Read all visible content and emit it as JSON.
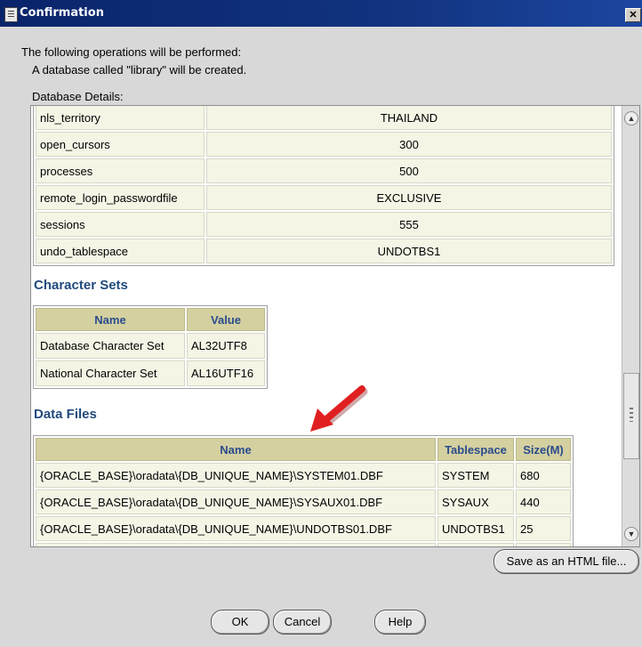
{
  "window": {
    "title": "Confirmation",
    "close_label": "✕"
  },
  "intro": {
    "line1": "The following operations will be performed:",
    "line2": "A database called \"library\" will be created.",
    "details_label": "Database Details:"
  },
  "parameters": [
    {
      "name": "nls_territory",
      "value": "THAILAND"
    },
    {
      "name": "open_cursors",
      "value": "300"
    },
    {
      "name": "processes",
      "value": "500"
    },
    {
      "name": "remote_login_passwordfile",
      "value": "EXCLUSIVE"
    },
    {
      "name": "sessions",
      "value": "555"
    },
    {
      "name": "undo_tablespace",
      "value": "UNDOTBS1"
    }
  ],
  "character_sets": {
    "heading": "Character Sets",
    "columns": [
      "Name",
      "Value"
    ],
    "rows": [
      {
        "name": "Database Character Set",
        "value": "AL32UTF8"
      },
      {
        "name": "National Character Set",
        "value": "AL16UTF16"
      }
    ]
  },
  "data_files": {
    "heading": "Data Files",
    "columns": [
      "Name",
      "Tablespace",
      "Size(M)"
    ],
    "rows": [
      {
        "name": "{ORACLE_BASE}\\oradata\\{DB_UNIQUE_NAME}\\SYSTEM01.DBF",
        "tablespace": "SYSTEM",
        "size": "680"
      },
      {
        "name": "{ORACLE_BASE}\\oradata\\{DB_UNIQUE_NAME}\\SYSAUX01.DBF",
        "tablespace": "SYSAUX",
        "size": "440"
      },
      {
        "name": "{ORACLE_BASE}\\oradata\\{DB_UNIQUE_NAME}\\UNDOTBS01.DBF",
        "tablespace": "UNDOTBS1",
        "size": "25"
      }
    ]
  },
  "buttons": {
    "save_html": "Save as an HTML file...",
    "ok": "OK",
    "cancel": "Cancel",
    "help": "Help"
  },
  "colors": {
    "title_bar": "#0a246a",
    "heading": "#224b7d",
    "table_header": "#d4d0a0",
    "cell_bg": "#f5f5e6",
    "annotation_arrow": "#e02020"
  },
  "icons": {
    "window_icon": "document-icon",
    "annotation": "red-arrow-icon"
  }
}
